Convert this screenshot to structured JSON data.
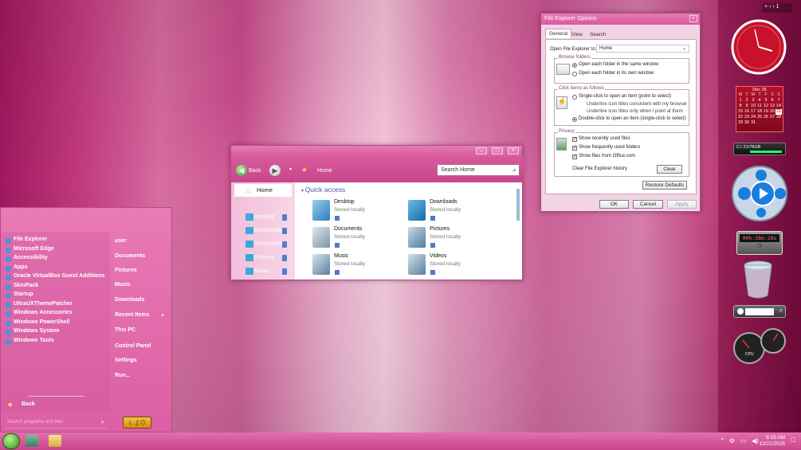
{
  "explorer": {
    "back_label": "Back",
    "location": "Home",
    "search_placeholder": "Search Home",
    "nav": [
      {
        "label": "Home"
      },
      {
        "label": "Desktop"
      },
      {
        "label": "Downloads"
      },
      {
        "label": "Documents"
      },
      {
        "label": "Pictures"
      },
      {
        "label": "Music"
      }
    ],
    "section_title": "Quick access",
    "tiles": [
      {
        "name": "Desktop",
        "sub": "Stored locally"
      },
      {
        "name": "Downloads",
        "sub": "Stored locally"
      },
      {
        "name": "Documents",
        "sub": "Stored locally"
      },
      {
        "name": "Pictures",
        "sub": "Stored locally"
      },
      {
        "name": "Music",
        "sub": "Stored locally"
      },
      {
        "name": "Videos",
        "sub": "Stored locally"
      }
    ]
  },
  "options": {
    "title": "File Explorer Options",
    "tabs": [
      "General",
      "View",
      "Search"
    ],
    "open_to_label": "Open File Explorer to:",
    "open_to_value": "Home",
    "browse_group": "Browse folders",
    "browse_opt1": "Open each folder in the same window",
    "browse_opt2": "Open each folder in its own window",
    "click_group": "Click items as follows",
    "click_opt1": "Single-click to open an item (point to select)",
    "click_sub1": "Underline icon titles consistent with my browser",
    "click_sub2": "Underline icon titles only when I point at them",
    "click_opt2": "Double-click to open an item (single-click to select)",
    "privacy_group": "Privacy",
    "privacy_opt1": "Show recently used files",
    "privacy_opt2": "Show frequently used folders",
    "privacy_opt3": "Show files from Office.com",
    "clear_history_label": "Clear File Explorer history",
    "clear_button": "Clear",
    "restore_button": "Restore Defaults",
    "ok_button": "OK",
    "cancel_button": "Cancel",
    "apply_button": "Apply"
  },
  "start_menu": {
    "programs": [
      "File Explorer",
      "Microsoft Edge",
      "Accessibility",
      "Apps",
      "Oracle VirtualBox Guest Additions",
      "SkinPack",
      "Startup",
      "UltraUXThemePatcher",
      "Windows Accessories",
      "Windows PowerShell",
      "Windows System",
      "Windows Tools"
    ],
    "right": [
      "user",
      "Documents",
      "Pictures",
      "Music",
      "Downloads",
      "Recent Items",
      "This PC",
      "Control Panel",
      "Settings",
      "Run..."
    ],
    "back_label": "Back",
    "search_placeholder": "Search programs and files"
  },
  "calendar": {
    "month": "Dec 25",
    "day_headers": [
      "M",
      "T",
      "W",
      "T",
      "F",
      "S",
      "S"
    ],
    "weeks": [
      [
        "1",
        "2",
        "3",
        "4",
        "5",
        "6",
        "7"
      ],
      [
        "8",
        "9",
        "10",
        "11",
        "12",
        "13",
        "14"
      ],
      [
        "15",
        "16",
        "17",
        "18",
        "19",
        "20",
        "21"
      ],
      [
        "22",
        "23",
        "24",
        "25",
        "26",
        "27",
        "28"
      ],
      [
        "29",
        "30",
        "31",
        "",
        "",
        "",
        ""
      ]
    ]
  },
  "gadgets": {
    "disk_text": "C:\\ 21/78GB",
    "timer": "00h:38m:28s",
    "cpu_label": "CPU",
    "top_plus": "+",
    "top_count": "1"
  },
  "taskbar": {
    "time": "9:15 AM",
    "date": "12/21/2025"
  },
  "colors": {
    "accent": "#d95a9e",
    "highlight": "#3e5fa6"
  }
}
